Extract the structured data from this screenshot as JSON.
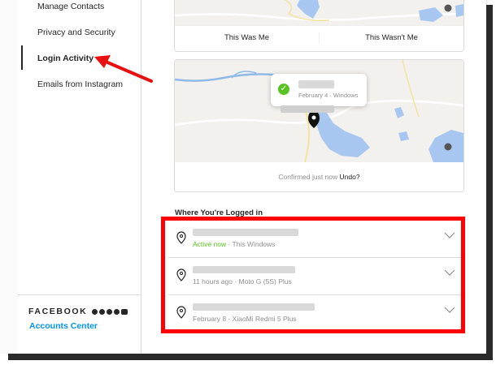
{
  "sidebar": {
    "items": [
      {
        "label": "Manage Contacts"
      },
      {
        "label": "Privacy and Security"
      },
      {
        "label": "Login Activity"
      },
      {
        "label": "Emails from Instagram"
      }
    ],
    "facebook_label": "FACEBOOK",
    "accounts_center": "Accounts Center"
  },
  "login_cards": {
    "this_was_me": "This Was Me",
    "this_wasnt_me": "This Wasn't Me",
    "popup_date": "February 4 · Windows",
    "confirm_text": "Confirmed just now",
    "undo": "Undo?"
  },
  "sessions_title": "Where You're Logged in",
  "sessions": [
    {
      "status": "Active now",
      "detail": " · This Windows"
    },
    {
      "status": "",
      "detail": "11 hours ago · Moto G (5S) Plus"
    },
    {
      "status": "",
      "detail": "February 8 · XiaoMi Redmi 5 Plus"
    }
  ],
  "colors": {
    "accent": "#0095f6",
    "active": "#58c322",
    "highlight": "#ff0000"
  }
}
